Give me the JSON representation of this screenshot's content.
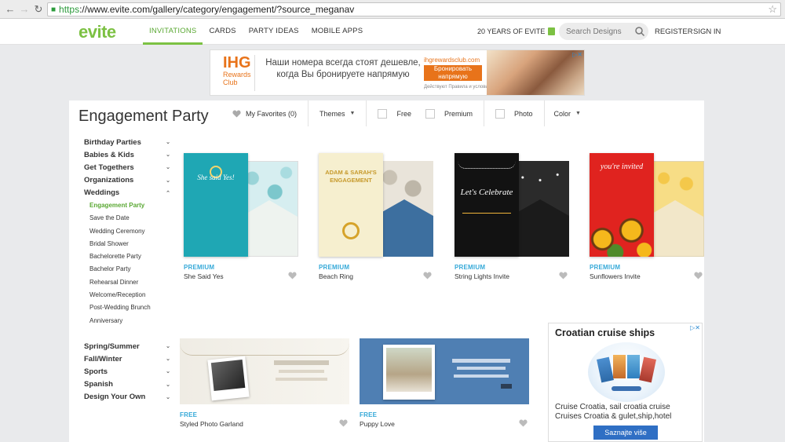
{
  "browser": {
    "url_scheme": "https",
    "url_rest": "://www.evite.com/gallery/category/engagement/?source_meganav"
  },
  "header": {
    "logo": "evite",
    "nav": [
      "INVITATIONS",
      "CARDS",
      "PARTY IDEAS",
      "MOBILE APPS"
    ],
    "anniversary": "20 YEARS OF EVITE",
    "search_placeholder": "Search Designs",
    "register": "REGISTER",
    "signin": "SIGN IN"
  },
  "ad_top": {
    "brand": "IHG",
    "brand_sub": "Rewards Club",
    "headline": "Наши номера всегда стоят дешевле, когда Вы бронируете напрямую",
    "url": "ihgrewardsclub.com",
    "button": "Бронировать напрямую",
    "fine": "Действуют Правила и условия"
  },
  "page": {
    "title": "Engagement Party",
    "favorites": "My Favorites (0)",
    "themes": "Themes",
    "free": "Free",
    "premium": "Premium",
    "photo": "Photo",
    "color": "Color"
  },
  "sidebar": {
    "top_categories": [
      "Birthday Parties",
      "Babies & Kids",
      "Get Togethers",
      "Organizations",
      "Weddings"
    ],
    "wedding_subs": [
      "Engagement Party",
      "Save the Date",
      "Wedding Ceremony",
      "Bridal Shower",
      "Bachelorette Party",
      "Bachelor Party",
      "Rehearsal Dinner",
      "Welcome/Reception",
      "Post-Wedding Brunch",
      "Anniversary"
    ],
    "bottom_categories": [
      "Spring/Summer",
      "Fall/Winter",
      "Sports",
      "Spanish",
      "Design Your Own"
    ]
  },
  "cards": [
    {
      "tier": "PREMIUM",
      "name": "She Said Yes",
      "inv_line": "She said Yes!"
    },
    {
      "tier": "PREMIUM",
      "name": "Beach Ring",
      "inv_line": "ADAM & SARAH'S ENGAGEMENT"
    },
    {
      "tier": "PREMIUM",
      "name": "String Lights Invite",
      "inv_line": "Let's Celebrate"
    },
    {
      "tier": "PREMIUM",
      "name": "Sunflowers Invite",
      "inv_line": "you're invited"
    }
  ],
  "wide_cards": [
    {
      "tier": "FREE",
      "name": "Styled Photo Garland"
    },
    {
      "tier": "FREE",
      "name": "Puppy Love"
    }
  ],
  "ad_side": {
    "title": "Croatian cruise ships",
    "text_1": "Cruise Croatia, sail croatia cruise",
    "text_2": "Cruises Croatia & gulet,ship,hotel",
    "button": "Saznajte više"
  },
  "colors": {
    "accent": "#7cc143",
    "premium": "#35a9d8"
  }
}
